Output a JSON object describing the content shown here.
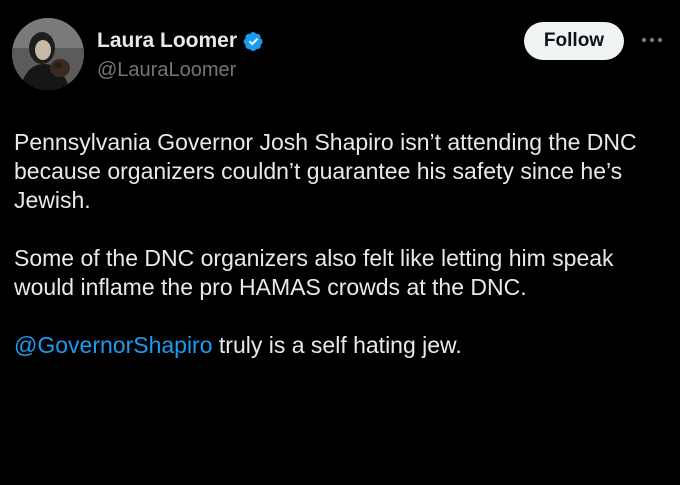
{
  "author": {
    "display_name": "Laura Loomer",
    "handle": "@LauraLoomer",
    "verified": true,
    "verified_icon": "verified-badge-icon",
    "verified_color": "#1d9bf0"
  },
  "actions": {
    "follow_label": "Follow",
    "more_icon": "more-horizontal-icon"
  },
  "tweet": {
    "paragraphs": [
      "Pennsylvania Governor Josh Shapiro isn’t attending the DNC because organizers couldn’t guarantee his safety since he’s Jewish.",
      "Some of the DNC organizers also felt like letting him speak would inflame the pro HAMAS crowds at the DNC."
    ],
    "last_paragraph": {
      "mention": "@GovernorShapiro",
      "text": " truly is a self hating jew."
    }
  },
  "colors": {
    "background": "#000000",
    "text": "#e7e9ea",
    "secondary_text": "#71767b",
    "link": "#1d9bf0",
    "button_bg": "#eff3f4",
    "button_text": "#0f1419"
  }
}
